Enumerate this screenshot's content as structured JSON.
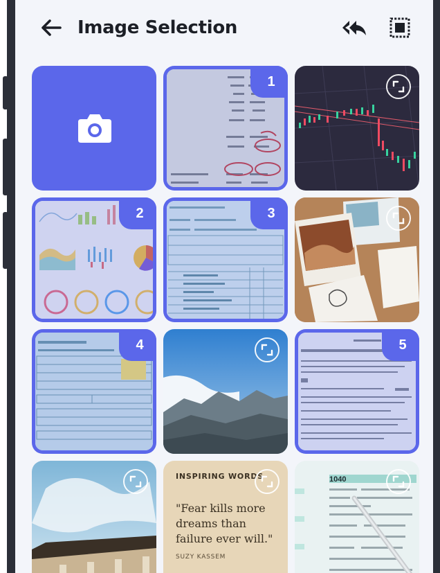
{
  "header": {
    "title": "Image Selection",
    "back_icon": "arrow-left-icon",
    "reply_all_icon": "reply-all-icon",
    "select_all_icon": "select-all-icon"
  },
  "colors": {
    "accent": "#5b67ea",
    "screen_bg": "#f3f5fa",
    "title": "#1c1f26"
  },
  "tiles": [
    {
      "kind": "camera",
      "icon": "camera-icon"
    },
    {
      "kind": "photo",
      "subject": "receipt-paper",
      "selected": true,
      "order": "1"
    },
    {
      "kind": "photo",
      "subject": "stock-chart",
      "selected": false
    },
    {
      "kind": "photo",
      "subject": "dashboard-charts",
      "selected": true,
      "order": "2"
    },
    {
      "kind": "photo",
      "subject": "tax-form",
      "selected": true,
      "order": "3"
    },
    {
      "kind": "photo",
      "subject": "postcards",
      "selected": false
    },
    {
      "kind": "photo",
      "subject": "tax-form",
      "selected": true,
      "order": "4"
    },
    {
      "kind": "photo",
      "subject": "mountains",
      "selected": false
    },
    {
      "kind": "photo",
      "subject": "document",
      "selected": true,
      "order": "5"
    },
    {
      "kind": "photo",
      "subject": "building-sky",
      "selected": false
    },
    {
      "kind": "quote",
      "selected": false,
      "quote_title": "INSPIRING WORDS",
      "quote_text": "\"Fear kills more dreams than failure ever will.\"",
      "quote_author": "SUZY KASSEM"
    },
    {
      "kind": "photo",
      "subject": "1040-form-pen",
      "selected": false,
      "form_label": "1040"
    }
  ]
}
